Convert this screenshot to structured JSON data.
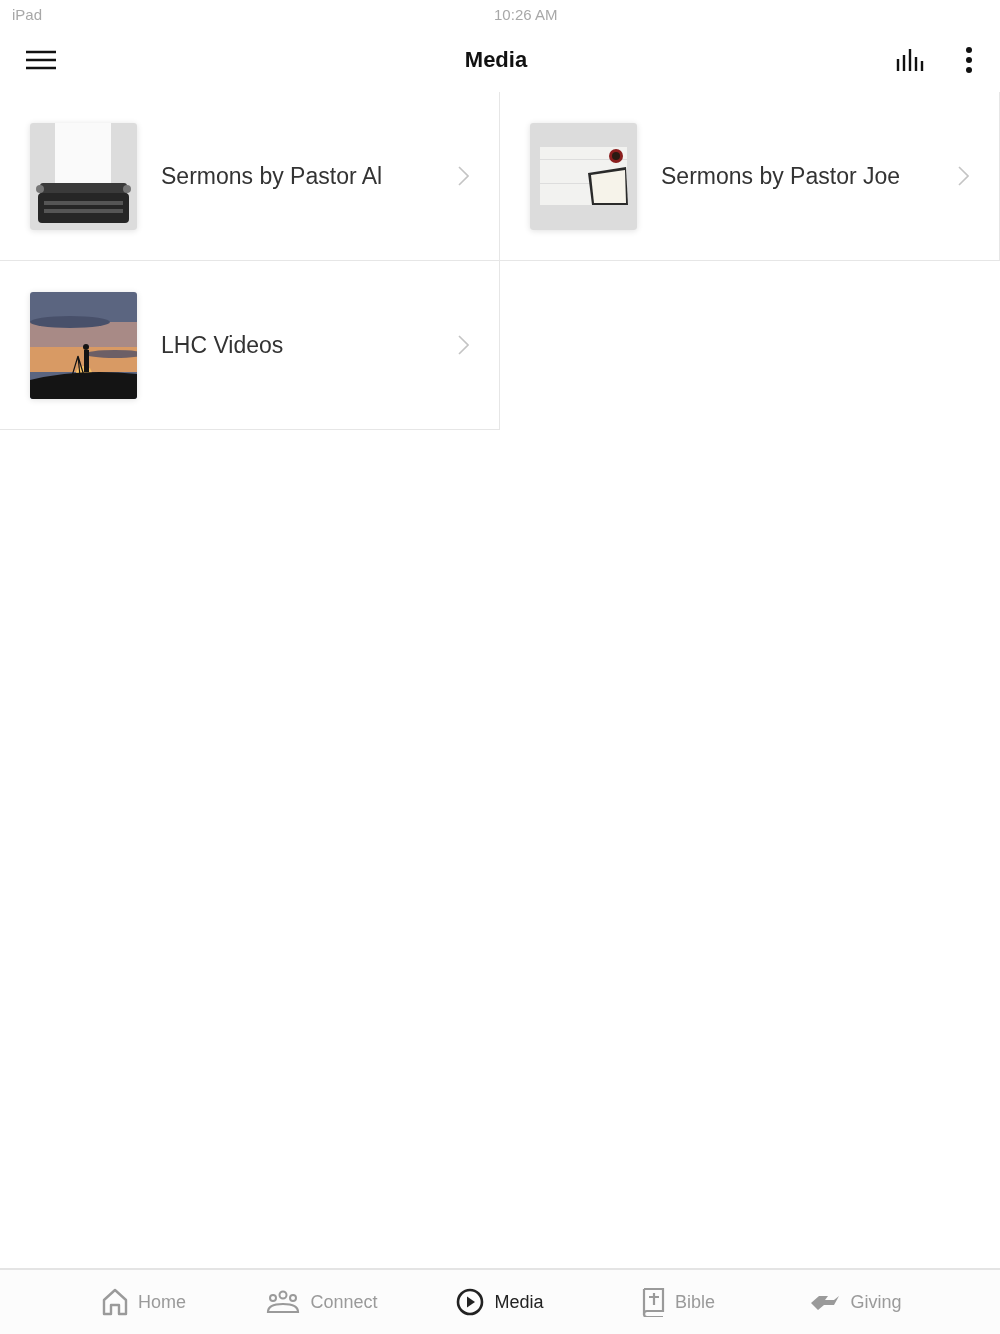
{
  "status_bar": {
    "device": "iPad",
    "time": "10:26 AM"
  },
  "header": {
    "title": "Media"
  },
  "items": [
    {
      "title": "Sermons by Pastor Al",
      "kind": "picture"
    },
    {
      "title": "Sermons by Pastor Joe",
      "kind": "picture"
    },
    {
      "title": "LHC Videos",
      "kind": "picture"
    }
  ],
  "tabs": [
    {
      "label": "Home",
      "kind": "home",
      "selected": false
    },
    {
      "label": "Connect",
      "kind": "people",
      "selected": false
    },
    {
      "label": "Media",
      "kind": "play",
      "selected": true
    },
    {
      "label": "Bible",
      "kind": "book",
      "selected": false
    },
    {
      "label": "Giving",
      "kind": "hand",
      "selected": false
    }
  ]
}
